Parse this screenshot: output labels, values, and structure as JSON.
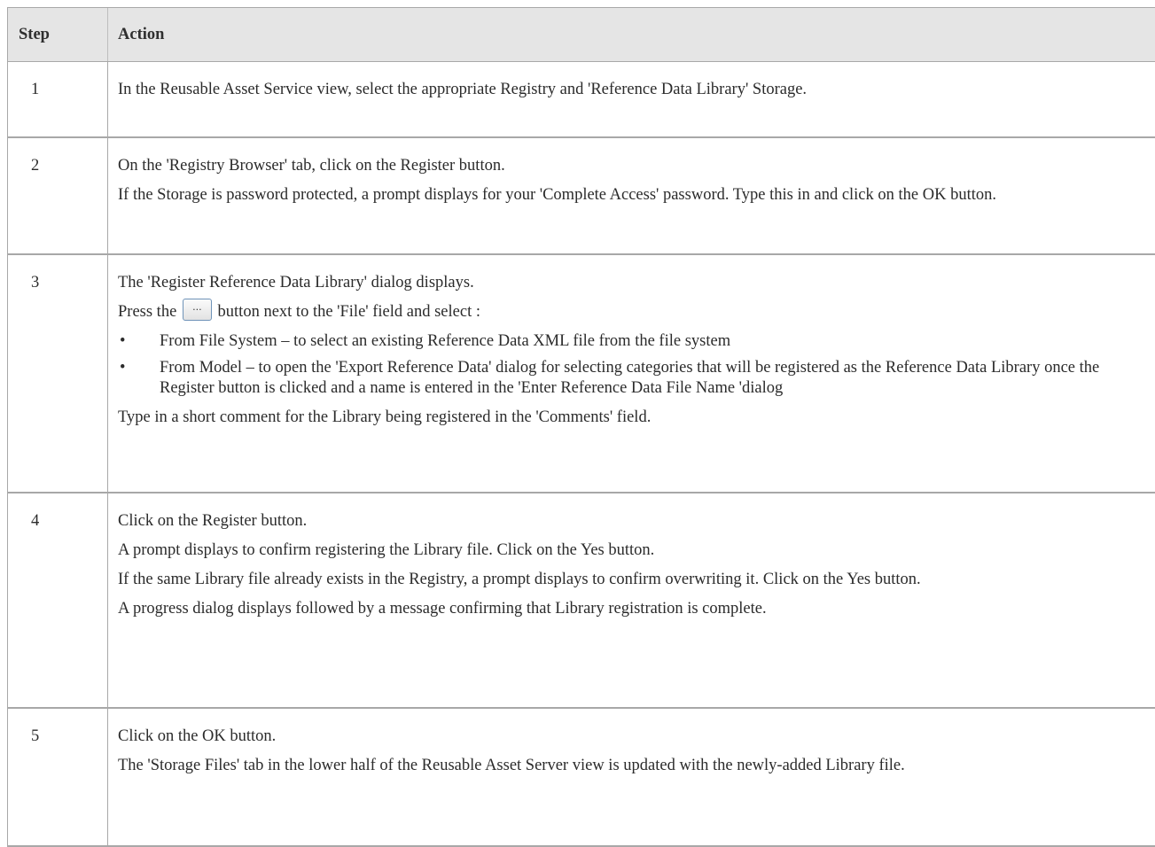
{
  "table": {
    "headers": [
      "Step",
      "Action"
    ],
    "rows": [
      {
        "step": "1",
        "paragraphs": [
          "In the Reusable Asset Service view, select the appropriate Registry and 'Reference Data Library' Storage."
        ]
      },
      {
        "step": "2",
        "paragraphs": [
          "On the 'Registry Browser' tab, click on the Register button.",
          "If the Storage is password protected, a prompt displays for your 'Complete Access' password. Type this in and click on the OK button."
        ]
      },
      {
        "step": "3",
        "intro": "The 'Register Reference Data Library' dialog displays.",
        "press_before": "Press the",
        "button_glyph": "...",
        "press_after": "button next to the 'File' field and select :",
        "bullet_glyph": "•",
        "bullets": [
          "From File System – to select an existing Reference Data XML file from the file system",
          "From Model – to open the 'Export Reference Data' dialog for selecting categories that will be registered as the Reference Data Library once the Register button is clicked and a name is entered in the 'Enter Reference Data File Name 'dialog"
        ],
        "outro": "Type in a short comment for the Library being registered in the 'Comments' field."
      },
      {
        "step": "4",
        "paragraphs": [
          "Click on the Register button.",
          "A prompt displays to confirm registering the Library file. Click on the Yes button.",
          "If the same Library file already exists in the Registry, a prompt displays to confirm overwriting it. Click on the Yes button.",
          "A progress dialog displays followed by a message confirming that Library registration is complete."
        ]
      },
      {
        "step": "5",
        "paragraphs": [
          "Click on the OK button.",
          "The 'Storage Files' tab in the lower half of the Reusable Asset Server view is updated with the newly-added Library file."
        ]
      }
    ]
  }
}
